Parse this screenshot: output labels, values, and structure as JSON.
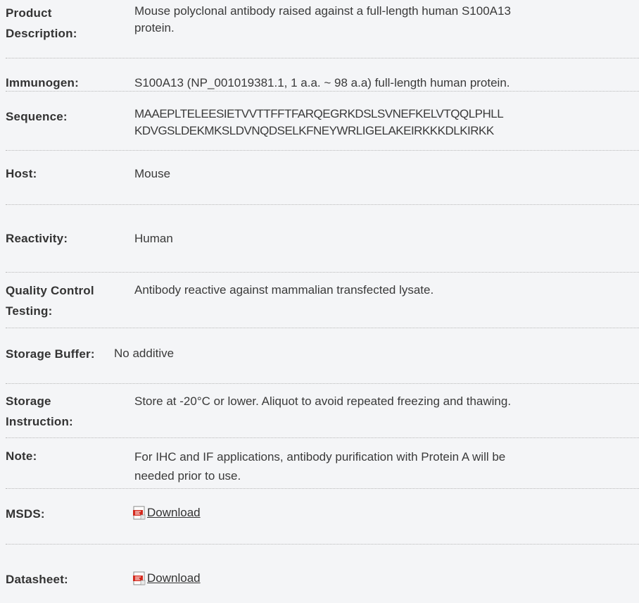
{
  "rows": [
    {
      "label": "Product Description:",
      "label_lines": [
        "Product",
        "Description:"
      ],
      "value_lines": [
        "Mouse polyclonal antibody raised against a full-length human S100A13",
        "protein."
      ]
    },
    {
      "label": "Immunogen:",
      "value": "S100A13 (NP_001019381.1, 1 a.a. ~ 98 a.a) full-length human protein."
    },
    {
      "label": "Sequence:",
      "value_lines": [
        "MAAEPLTELEESIETVVTTFFTFARQEGRKDSLSVNEFKELVTQQLPHLL",
        "KDVGSLDEKMKSLDVNQDSELKFNEYWRLIGELAKEIRKKKDLKIRKK"
      ]
    },
    {
      "label": "Host:",
      "value": "Mouse"
    },
    {
      "label": "Reactivity:",
      "value": "Human"
    },
    {
      "label": "Quality Control Testing:",
      "label_lines": [
        "Quality Control",
        "Testing:"
      ],
      "value": "Antibody reactive against mammalian transfected lysate."
    },
    {
      "label": "Storage Buffer:",
      "value": "No additive"
    },
    {
      "label": "Storage Instruction:",
      "label_lines": [
        "Storage",
        "Instruction:"
      ],
      "value": "Store at -20°C or lower. Aliquot to avoid repeated freezing and thawing."
    },
    {
      "label": "Note:",
      "value_lines": [
        "For IHC and IF applications, antibody purification with Protein A will be",
        "needed prior to use."
      ]
    },
    {
      "label": "MSDS:",
      "link_text": "Download",
      "icon": "pdf-icon"
    },
    {
      "label": "Datasheet:",
      "link_text": "Download",
      "icon": "pdf-icon"
    }
  ]
}
